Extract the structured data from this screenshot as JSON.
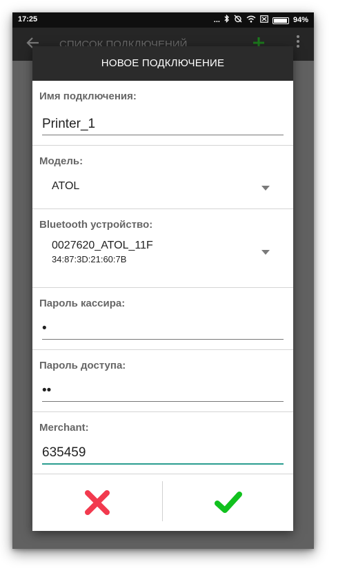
{
  "statusbar": {
    "time": "17:25",
    "dots": "...",
    "battery": "94%"
  },
  "appbar": {
    "title": "СПИСОК ПОДКЛЮЧЕНИЙ"
  },
  "dialog": {
    "title": "НОВОЕ ПОДКЛЮЧЕНИЕ",
    "connection_name": {
      "label": "Имя подключения:",
      "value": "Printer_1"
    },
    "model": {
      "label": "Модель:",
      "value": "ATOL"
    },
    "bluetooth": {
      "label": "Bluetooth устройство:",
      "name": "0027620_ATOL_11F",
      "address": "34:87:3D:21:60:7B"
    },
    "cashier_password": {
      "label": "Пароль кассира:",
      "value": "•"
    },
    "access_password": {
      "label": "Пароль доступа:",
      "value": "••"
    },
    "merchant": {
      "label": "Merchant:",
      "value": "635459"
    }
  },
  "colors": {
    "cancel": "#f23a4e",
    "confirm": "#11c11e",
    "focus_underline": "#2a9d8f"
  },
  "icons": {
    "cancel": "cross-icon",
    "confirm": "check-icon"
  }
}
